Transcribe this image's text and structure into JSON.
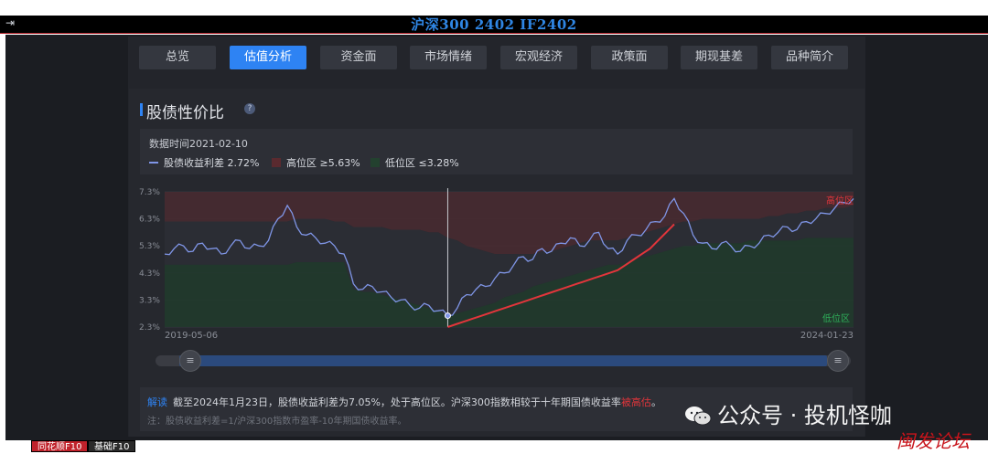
{
  "window": {
    "title": "沪深300 2402 IF2402"
  },
  "tabs": [
    {
      "label": "总览",
      "active": false
    },
    {
      "label": "估值分析",
      "active": true
    },
    {
      "label": "资金面",
      "active": false
    },
    {
      "label": "市场情绪",
      "active": false
    },
    {
      "label": "宏观经济",
      "active": false
    },
    {
      "label": "政策面",
      "active": false
    },
    {
      "label": "期现基差",
      "active": false
    },
    {
      "label": "品种简介",
      "active": false
    }
  ],
  "section": {
    "title": "股债性价比",
    "help": "?"
  },
  "info": {
    "date_label": "数据时间2021-02-10",
    "legend": [
      {
        "label": "股债收益利差 2.72%",
        "type": "line",
        "color": "#7f95e6"
      },
      {
        "label": "高位区 ≥5.63%",
        "type": "box",
        "color": "#5a2a2f"
      },
      {
        "label": "低位区 ≤3.28%",
        "type": "box",
        "color": "#23412f"
      }
    ]
  },
  "chart_data": {
    "type": "line",
    "x_start": "2019-05-06",
    "x_end": "2024-01-23",
    "y_ticks": [
      "7.3%",
      "6.3%",
      "5.3%",
      "4.3%",
      "3.3%",
      "2.3%"
    ],
    "ylim": [
      2.3,
      7.3
    ],
    "zone_high_label": "高位区",
    "zone_low_label": "低位区",
    "series": [
      {
        "name": "股债收益利差",
        "color": "#7f95e6",
        "values": [
          5.0,
          5.2,
          5.3,
          5.1,
          5.4,
          5.2,
          5.0,
          5.3,
          5.5,
          5.2,
          5.3,
          5.5,
          6.3,
          6.8,
          6.0,
          5.7,
          5.6,
          5.4,
          5.3,
          5.0,
          3.9,
          3.7,
          3.8,
          3.6,
          3.4,
          3.3,
          3.1,
          3.0,
          3.1,
          2.9,
          2.72,
          3.0,
          3.5,
          3.7,
          3.8,
          4.1,
          4.3,
          4.6,
          4.9,
          4.8,
          5.2,
          5.1,
          5.4,
          5.6,
          5.3,
          5.5,
          5.8,
          5.2,
          5.0,
          5.5,
          5.7,
          5.9,
          6.2,
          6.4,
          7.05,
          6.5,
          5.7,
          5.4,
          5.2,
          5.4,
          5.3,
          5.1,
          5.3,
          5.4,
          5.7,
          5.8,
          6.0,
          5.9,
          6.2,
          6.3,
          6.5,
          6.7,
          6.9,
          7.05
        ]
      }
    ],
    "percentile_high": [
      6.2,
      6.2,
      6.2,
      6.2,
      6.2,
      6.2,
      6.2,
      6.2,
      6.2,
      6.2,
      6.2,
      6.2,
      6.2,
      6.2,
      6.3,
      6.3,
      6.3,
      6.3,
      6.2,
      6.2,
      6.0,
      6.0,
      6.0,
      6.0,
      5.9,
      5.9,
      5.9,
      5.9,
      5.8,
      5.8,
      5.6,
      5.5,
      5.3,
      5.2,
      5.1,
      5.0,
      5.0,
      5.0,
      5.0,
      5.0,
      5.1,
      5.1,
      5.2,
      5.3,
      5.4,
      5.5,
      5.5,
      5.5,
      5.5,
      5.6,
      5.7,
      5.8,
      5.9,
      6.0,
      6.1,
      6.2,
      6.2,
      6.3,
      6.3,
      6.3,
      6.3,
      6.3,
      6.3,
      6.3,
      6.4,
      6.4,
      6.5,
      6.5,
      6.6,
      6.6,
      6.7,
      6.7,
      6.7,
      6.8
    ],
    "percentile_low": [
      4.6,
      4.6,
      4.6,
      4.6,
      4.6,
      4.6,
      4.6,
      4.6,
      4.6,
      4.6,
      4.6,
      4.6,
      4.6,
      4.6,
      4.7,
      4.7,
      4.7,
      4.7,
      4.7,
      4.7,
      3.7,
      3.6,
      3.6,
      3.5,
      3.4,
      3.3,
      3.2,
      3.1,
      3.0,
      2.9,
      2.72,
      2.8,
      2.9,
      3.0,
      3.1,
      3.2,
      3.4,
      3.5,
      3.6,
      3.8,
      3.9,
      4.0,
      4.1,
      4.2,
      4.3,
      4.4,
      4.5,
      4.6,
      4.6,
      4.7,
      4.8,
      4.9,
      5.0,
      5.1,
      5.2,
      5.3,
      5.3,
      5.4,
      5.4,
      5.4,
      5.4,
      5.4,
      5.5,
      5.5,
      5.5,
      5.5,
      5.5,
      5.5,
      5.6,
      5.6,
      5.6,
      5.6,
      5.6,
      5.6
    ],
    "red_line": [
      2.3,
      2.4,
      2.5,
      2.6,
      2.7,
      2.8,
      2.9,
      3.0,
      3.1,
      3.2,
      3.3,
      3.4,
      3.5,
      3.6,
      3.7,
      3.8,
      3.9,
      4.0,
      4.1,
      4.2,
      4.3,
      4.4,
      4.6,
      4.8,
      5.0,
      5.2,
      5.5,
      5.8,
      6.1
    ],
    "red_line_start_index": 30,
    "cursor_index": 30
  },
  "slider": {
    "left_handle": "≡",
    "right_handle": "≡"
  },
  "notes": {
    "label": "解读",
    "text_main": "截至2024年1月23日，股债收益利差为7.05%，处于高位区。沪深300指数相较于十年期国债收益率",
    "text_highlight": "被高估",
    "text_end": "。",
    "formula": "注：股债收益利差=1/沪深300指数市盈率-10年期国债收益率。"
  },
  "bottom_tabs": {
    "a": "同花顺F10",
    "b": "基础F10"
  },
  "watermark": {
    "text": "公众号 · 投机怪咖",
    "forum": "闽发论坛"
  }
}
